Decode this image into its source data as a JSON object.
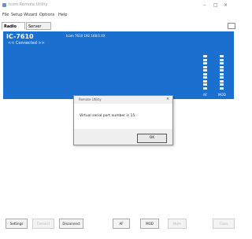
{
  "window": {
    "title": "Icom Remote Utility",
    "controls": [
      "–",
      "□",
      "×"
    ]
  },
  "menu": {
    "items": [
      "File",
      "Setup Wizard",
      "Options",
      "Help"
    ]
  },
  "tabs": [
    "Radio List",
    "Server List"
  ],
  "panel": {
    "device_name": "IC-7610",
    "status": "<< Connected >>",
    "info_title": "Icom 7610 192.168.0.XX",
    "indicator_labels": [
      "AF",
      "MOD"
    ]
  },
  "dialog": {
    "title": "Remote Utility",
    "close": "×",
    "message": "Virtual serial port number is 15.",
    "ok_label": "OK"
  },
  "bottom_buttons": [
    {
      "label": "Settings",
      "enabled": true
    },
    {
      "label": "Connect",
      "enabled": false
    },
    {
      "label": "Disconnect",
      "enabled": true
    },
    {
      "label": "AF",
      "enabled": true
    },
    {
      "label": "MOD",
      "enabled": true
    },
    {
      "label": "Mute",
      "enabled": false
    },
    {
      "label": "Close",
      "enabled": false
    }
  ]
}
